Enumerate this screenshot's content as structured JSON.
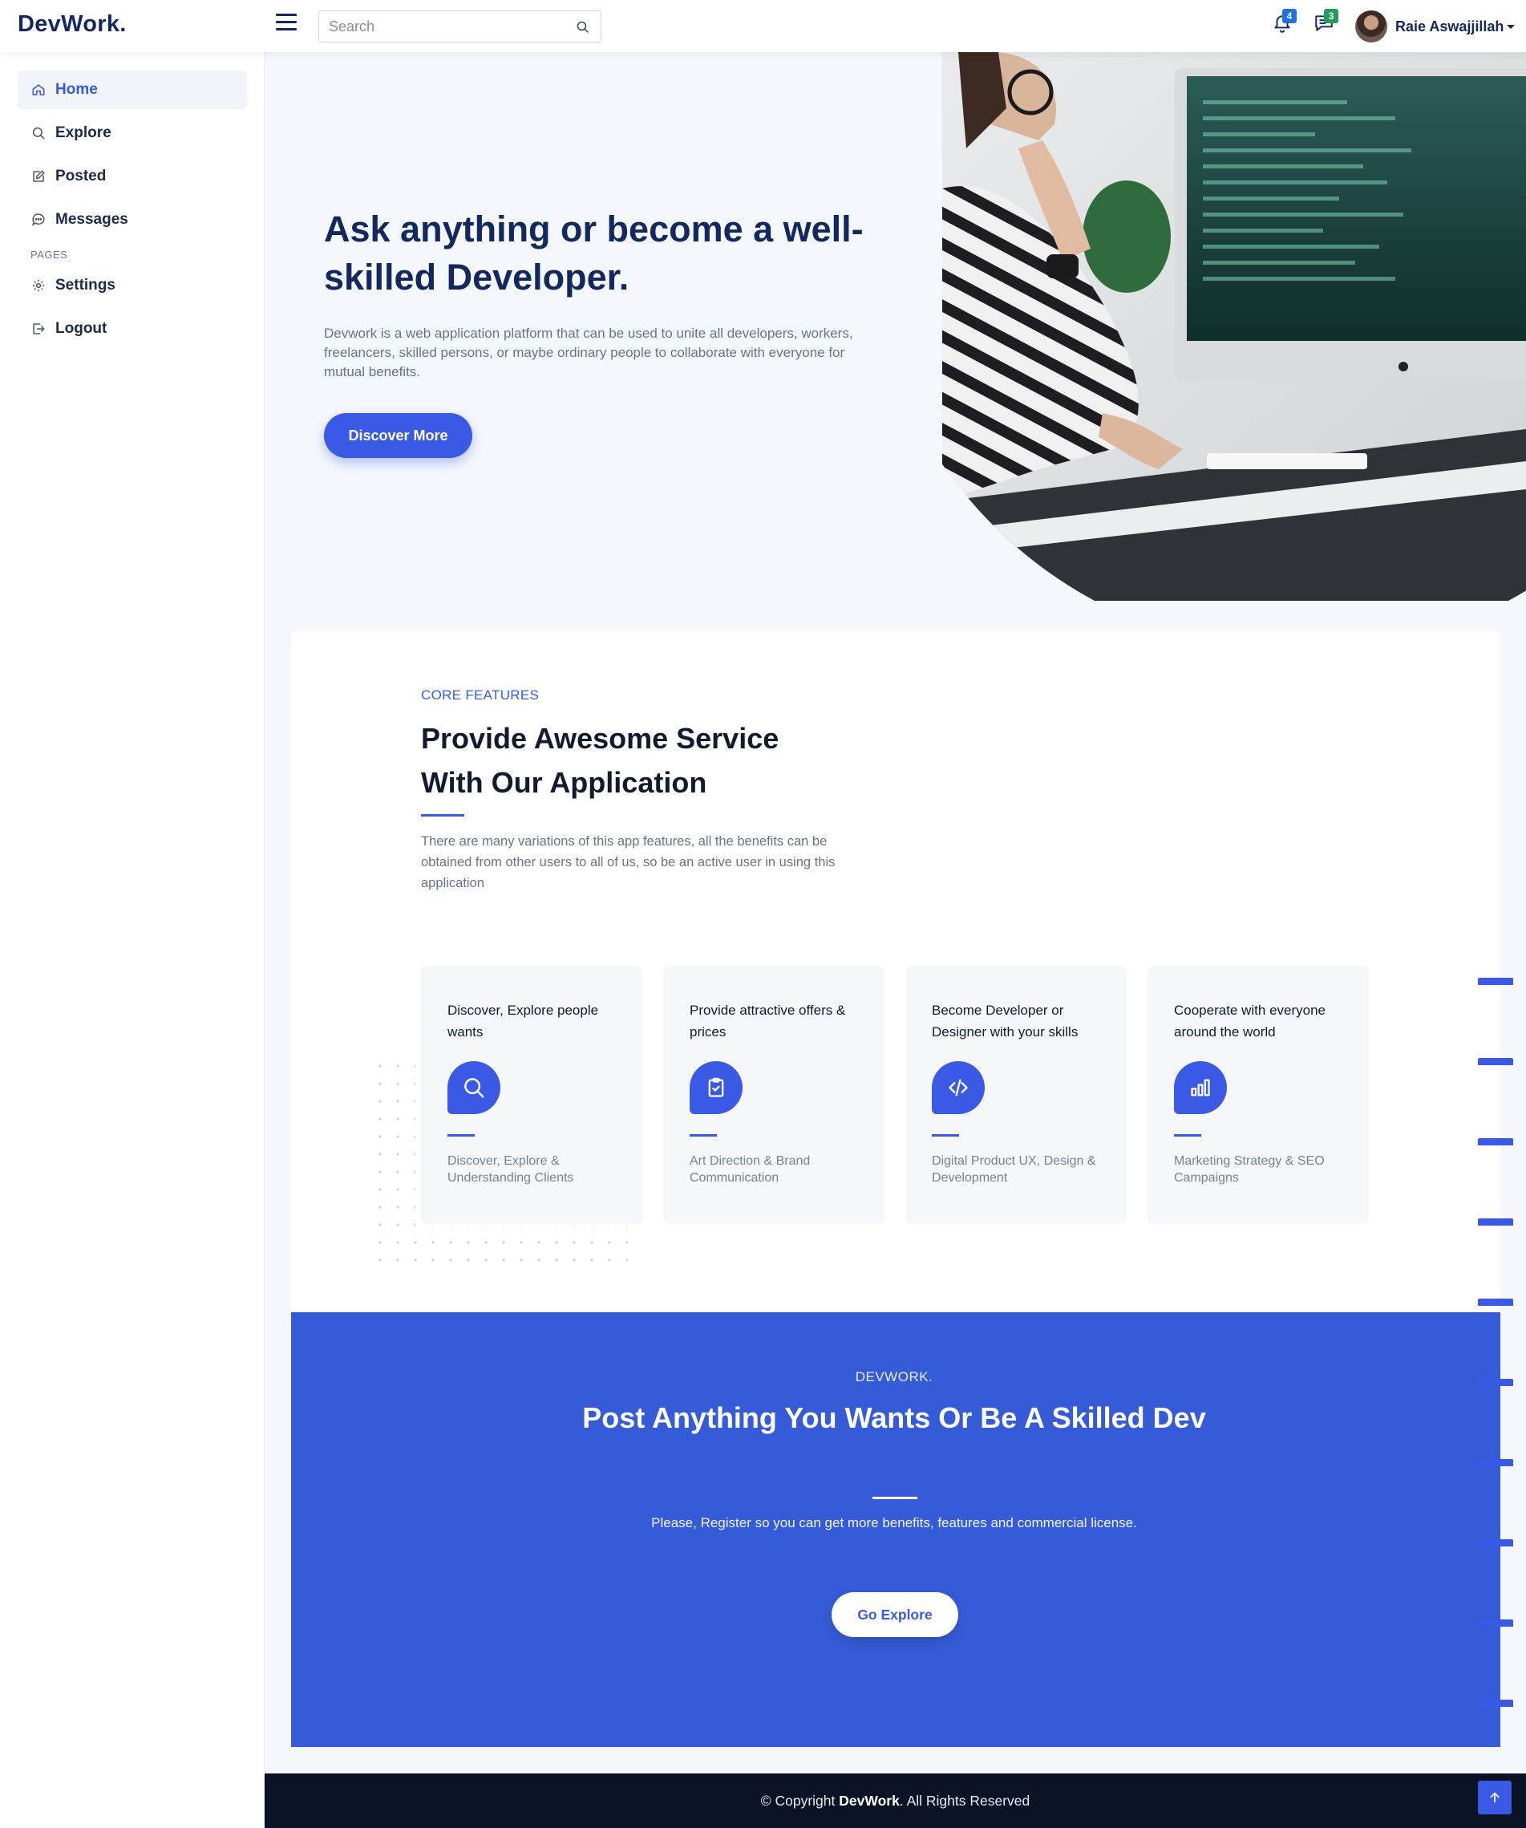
{
  "app": {
    "brand": "DevWork."
  },
  "header": {
    "search_placeholder": "Search",
    "notifications_count": "4",
    "messages_count": "3",
    "user_name": "Raie Aswajjillah"
  },
  "sidebar": {
    "items": [
      {
        "label": "Home",
        "icon": "home-icon",
        "active": true
      },
      {
        "label": "Explore",
        "icon": "search-icon"
      },
      {
        "label": "Posted",
        "icon": "edit-icon"
      },
      {
        "label": "Messages",
        "icon": "chat-icon"
      }
    ],
    "section_heading": "PAGES",
    "pages": [
      {
        "label": "Settings",
        "icon": "gear-icon"
      },
      {
        "label": "Logout",
        "icon": "logout-icon"
      }
    ]
  },
  "hero": {
    "title": "Ask anything or become a well-skilled Developer.",
    "text": "Devwork is a web application platform that can be used to unite all developers, workers, freelancers, skilled persons, or maybe ordinary people to collaborate with everyone for mutual benefits.",
    "button": "Discover More"
  },
  "features": {
    "kicker": "CORE FEATURES",
    "title": "Provide Awesome Service With Our Application",
    "text": "There are many variations of this app features, all the benefits can be obtained from other users to all of us, so be an active user in using this application",
    "cards": [
      {
        "title": "Discover, Explore people wants",
        "icon": "search-icon",
        "subtitle": "Discover, Explore & Understanding Clients"
      },
      {
        "title": "Provide attractive offers & prices",
        "icon": "clipboard-check-icon",
        "subtitle": "Art Direction & Brand Communication"
      },
      {
        "title": "Become Developer or Designer with your skills",
        "icon": "code-icon",
        "subtitle": "Digital Product UX, Design & Development"
      },
      {
        "title": "Cooperate with everyone around the world",
        "icon": "bar-chart-icon",
        "subtitle": "Marketing Strategy & SEO Campaigns"
      }
    ]
  },
  "cta": {
    "kicker": "DEVWORK.",
    "title": "Post Anything You Wants Or Be A Skilled Dev",
    "text": "Please, Register so you can get more benefits, features and commercial license.",
    "button": "Go Explore"
  },
  "footer": {
    "prefix": "© Copyright",
    "brand": "DevWork",
    "suffix": ". All Rights Reserved"
  },
  "colors": {
    "brand_navy": "#12285f",
    "accent_blue": "#3a5ae6",
    "cta_blue": "#365bd8",
    "footer_bg": "#0c1326",
    "notification_badge": "#1f6fe5",
    "message_badge": "#1e9e5a"
  }
}
